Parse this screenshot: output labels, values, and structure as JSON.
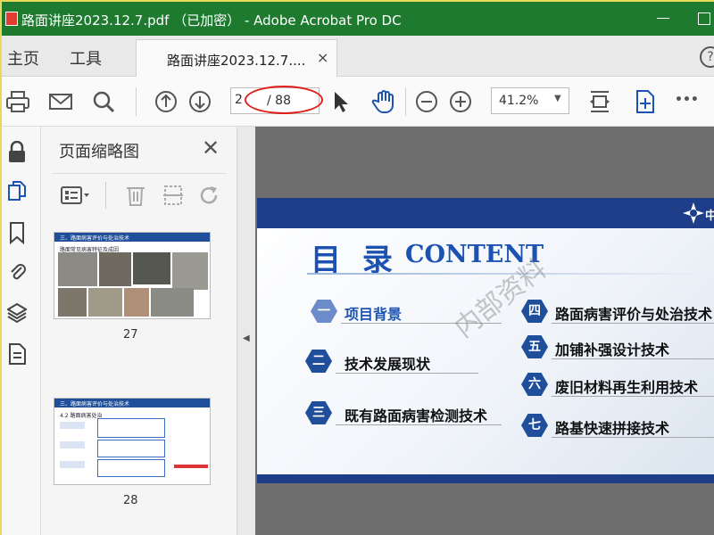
{
  "window": {
    "title": "路面讲座2023.12.7.pdf （已加密） - Adobe Acrobat Pro DC",
    "minimize_glyph": "—",
    "maximize_glyph": "□"
  },
  "tabs": {
    "home": "主页",
    "tools": "工具",
    "document": "路面讲座2023.12.7....",
    "close": "×",
    "help": "?"
  },
  "toolbar": {
    "page_current": "2",
    "page_total": "/ 88",
    "zoom": "41.2%",
    "zoom_arrow": "▼",
    "more": "•••"
  },
  "thumbnails_panel": {
    "title": "页面缩略图",
    "close": "✕",
    "thumbs": [
      {
        "number": "27",
        "bar_title": "三、路面病害评价与处治技术",
        "subtitle": "路面常见病害特征及成因"
      },
      {
        "number": "28",
        "bar_title": "三、路面病害评价与处治技术",
        "subtitle": "4.2 路面病害处治"
      }
    ]
  },
  "slide": {
    "title_cn": "目 录",
    "title_en": "CONTENT",
    "logo_text": "中",
    "items_left": [
      {
        "num": "一",
        "label": "项目背景"
      },
      {
        "num": "二",
        "label": "技术发展现状"
      },
      {
        "num": "三",
        "label": "既有路面病害检测技术"
      }
    ],
    "items_right": [
      {
        "num": "四",
        "label": "路面病害评价与处治技术"
      },
      {
        "num": "五",
        "label": "加铺补强设计技术"
      },
      {
        "num": "六",
        "label": "废旧材料再生利用技术"
      },
      {
        "num": "七",
        "label": "路基快速拼接技术"
      }
    ],
    "watermark": "内部资料"
  },
  "colors": {
    "titlebar": "#1d7a2f",
    "slide_blue": "#1c53b3",
    "band": "#1f3e8a",
    "annotation": "#e0201a"
  }
}
